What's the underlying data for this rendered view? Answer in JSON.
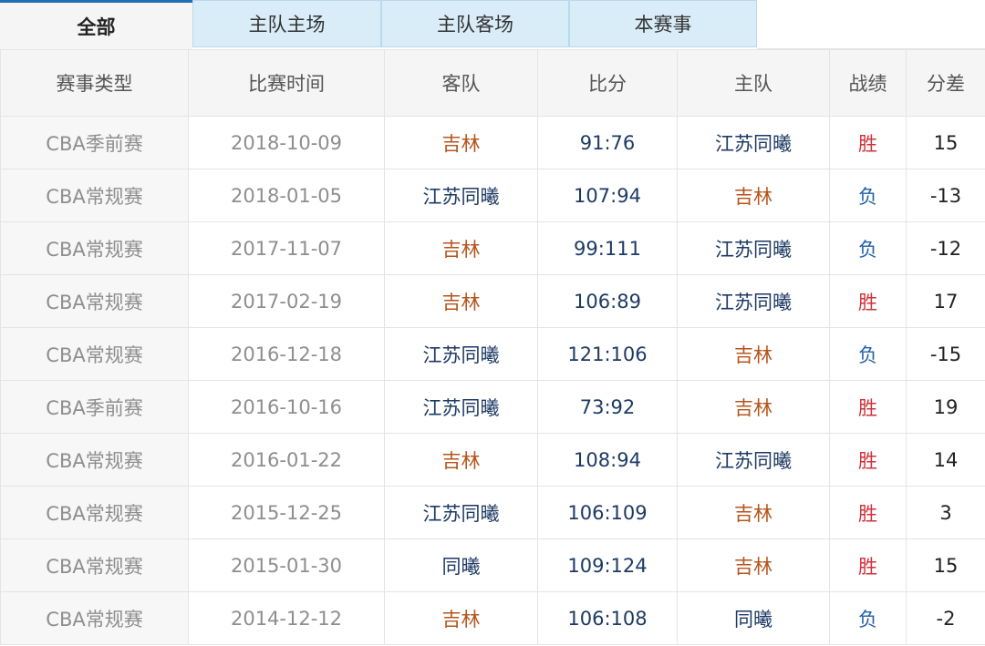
{
  "tabs": [
    {
      "label": "全部",
      "active": true
    },
    {
      "label": "主队主场",
      "active": false
    },
    {
      "label": "主队客场",
      "active": false
    },
    {
      "label": "本赛事",
      "active": false
    }
  ],
  "table": {
    "headers": [
      "赛事类型",
      "比赛时间",
      "客队",
      "比分",
      "主队",
      "战绩",
      "分差"
    ],
    "rows": [
      {
        "type": "CBA季前赛",
        "date": "2018-10-09",
        "away": "吉林",
        "score": "91:76",
        "home": "江苏同曦",
        "result": "胜",
        "diff": "15"
      },
      {
        "type": "CBA常规赛",
        "date": "2018-01-05",
        "away": "江苏同曦",
        "score": "107:94",
        "home": "吉林",
        "result": "负",
        "diff": "-13"
      },
      {
        "type": "CBA常规赛",
        "date": "2017-11-07",
        "away": "吉林",
        "score": "99:111",
        "home": "江苏同曦",
        "result": "负",
        "diff": "-12"
      },
      {
        "type": "CBA常规赛",
        "date": "2017-02-19",
        "away": "吉林",
        "score": "106:89",
        "home": "江苏同曦",
        "result": "胜",
        "diff": "17"
      },
      {
        "type": "CBA常规赛",
        "date": "2016-12-18",
        "away": "江苏同曦",
        "score": "121:106",
        "home": "吉林",
        "result": "负",
        "diff": "-15"
      },
      {
        "type": "CBA季前赛",
        "date": "2016-10-16",
        "away": "江苏同曦",
        "score": "73:92",
        "home": "吉林",
        "result": "胜",
        "diff": "19"
      },
      {
        "type": "CBA常规赛",
        "date": "2016-01-22",
        "away": "吉林",
        "score": "108:94",
        "home": "江苏同曦",
        "result": "胜",
        "diff": "14"
      },
      {
        "type": "CBA常规赛",
        "date": "2015-12-25",
        "away": "江苏同曦",
        "score": "106:109",
        "home": "吉林",
        "result": "胜",
        "diff": "3"
      },
      {
        "type": "CBA常规赛",
        "date": "2015-01-30",
        "away": "同曦",
        "score": "109:124",
        "home": "吉林",
        "result": "胜",
        "diff": "15"
      },
      {
        "type": "CBA常规赛",
        "date": "2014-12-12",
        "away": "吉林",
        "score": "106:108",
        "home": "同曦",
        "result": "负",
        "diff": "-2"
      }
    ]
  },
  "colors": {
    "active_tab_border": "#1f6fb6",
    "tab_background": "#d9edf9",
    "team_jilin": "#b5541b",
    "team_jiangsu": "#1d3a63",
    "win": "#d2313a",
    "lose": "#1f5fa8"
  }
}
